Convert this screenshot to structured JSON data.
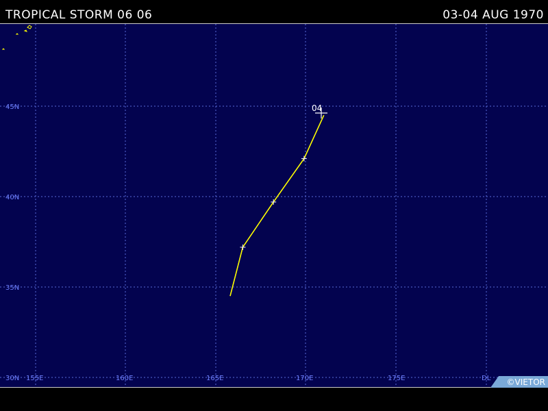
{
  "header": {
    "title": "TROPICAL STORM 06 06",
    "dates": "03-04 AUG 1970"
  },
  "map": {
    "background_color": "#03034f",
    "grid_color": "#5a6bd8",
    "track_color": "#ffff00",
    "lat_labels": [
      "45N",
      "40N",
      "35N",
      "30N"
    ],
    "lon_labels": [
      "155E",
      "160E",
      "165E",
      "170E",
      "175E",
      "DL"
    ],
    "track": [
      {
        "lat": 34.5,
        "lon": 165.8
      },
      {
        "lat": 37.2,
        "lon": 166.5
      },
      {
        "lat": 39.7,
        "lon": 168.2
      },
      {
        "lat": 42.1,
        "lon": 169.9
      },
      {
        "lat": 44.5,
        "lon": 171.0
      }
    ],
    "end_label": "04"
  },
  "credit": "©VIETOR"
}
